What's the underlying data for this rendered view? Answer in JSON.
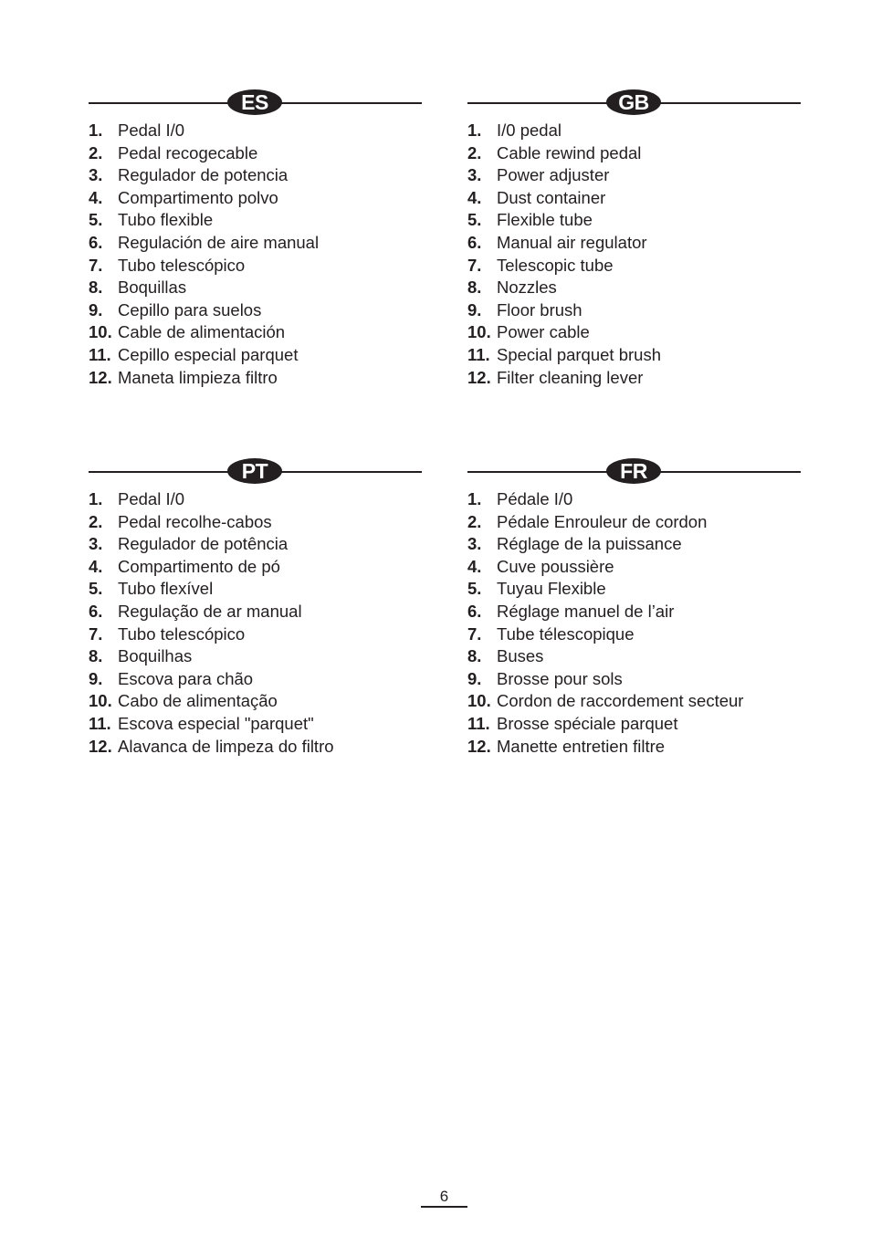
{
  "sections": [
    {
      "code": "ES",
      "items": [
        {
          "num": "1.",
          "label": "Pedal I/0"
        },
        {
          "num": "2.",
          "label": "Pedal recogecable"
        },
        {
          "num": "3.",
          "label": "Regulador de potencia"
        },
        {
          "num": "4.",
          "label": "Compartimento polvo"
        },
        {
          "num": "5.",
          "label": "Tubo flexible"
        },
        {
          "num": "6.",
          "label": "Regulación de aire manual"
        },
        {
          "num": "7.",
          "label": "Tubo telescópico"
        },
        {
          "num": "8.",
          "label": "Boquillas"
        },
        {
          "num": "9.",
          "label": "Cepillo para suelos"
        },
        {
          "num": "10.",
          "label": "Cable de alimentación"
        },
        {
          "num": "11.",
          "label": "Cepillo especial parquet"
        },
        {
          "num": "12.",
          "label": "Maneta limpieza filtro"
        }
      ]
    },
    {
      "code": "GB",
      "items": [
        {
          "num": "1.",
          "label": "I/0 pedal"
        },
        {
          "num": "2.",
          "label": "Cable rewind pedal"
        },
        {
          "num": "3.",
          "label": "Power adjuster"
        },
        {
          "num": "4.",
          "label": "Dust container"
        },
        {
          "num": "5.",
          "label": "Flexible tube"
        },
        {
          "num": "6.",
          "label": "Manual air regulator"
        },
        {
          "num": "7.",
          "label": "Telescopic tube"
        },
        {
          "num": "8.",
          "label": "Nozzles"
        },
        {
          "num": "9.",
          "label": "Floor brush"
        },
        {
          "num": "10.",
          "label": "Power cable"
        },
        {
          "num": "11.",
          "label": "Special parquet brush"
        },
        {
          "num": "12.",
          "label": "Filter cleaning lever"
        }
      ]
    },
    {
      "code": "PT",
      "items": [
        {
          "num": "1.",
          "label": "Pedal I/0"
        },
        {
          "num": "2.",
          "label": "Pedal recolhe-cabos"
        },
        {
          "num": "3.",
          "label": "Regulador de potência"
        },
        {
          "num": "4.",
          "label": "Compartimento de pó"
        },
        {
          "num": "5.",
          "label": "Tubo flexível"
        },
        {
          "num": "6.",
          "label": "Regulação de ar manual"
        },
        {
          "num": "7.",
          "label": "Tubo telescópico"
        },
        {
          "num": "8.",
          "label": "Boquilhas"
        },
        {
          "num": "9.",
          "label": "Escova para chão"
        },
        {
          "num": "10.",
          "label": "Cabo de alimentação"
        },
        {
          "num": "11.",
          "label": "Escova especial \"parquet\""
        },
        {
          "num": "12.",
          "label": "Alavanca de limpeza do filtro"
        }
      ]
    },
    {
      "code": "FR",
      "items": [
        {
          "num": "1.",
          "label": "Pédale I/0"
        },
        {
          "num": "2.",
          "label": "Pédale Enrouleur de cordon"
        },
        {
          "num": "3.",
          "label": "Réglage de la puissance"
        },
        {
          "num": "4.",
          "label": "Cuve poussière"
        },
        {
          "num": "5.",
          "label": "Tuyau Flexible"
        },
        {
          "num": "6.",
          "label": "Réglage manuel de l’air"
        },
        {
          "num": "7.",
          "label": "Tube télescopique"
        },
        {
          "num": "8.",
          "label": "Buses"
        },
        {
          "num": "9.",
          "label": "Brosse pour sols"
        },
        {
          "num": "10.",
          "label": "Cordon de raccordement secteur"
        },
        {
          "num": "11.",
          "label": "Brosse spéciale parquet"
        },
        {
          "num": "12.",
          "label": "Manette entretien filtre"
        }
      ]
    }
  ],
  "footer": {
    "page_number": "6"
  }
}
